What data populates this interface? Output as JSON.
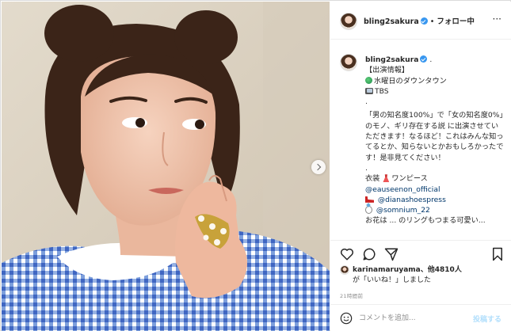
{
  "post": {
    "username": "bling2sakura",
    "separator": "•",
    "follow_label": "フォロー中",
    "more_label": "···",
    "caption": {
      "username": "bling2sakura",
      "after_name": ".",
      "line_1": "【出演情報】",
      "line_2": "水曜日のダウンタウン",
      "line_3": "TBS",
      "dot_1": ".",
      "body": "「男の知名度100%」で「女の知名度0%」のモノ、ギリ存在する説 に出演させていただきます！なるほど！これはみんな知ってるとか、知らないとかおもしろかったです！是非見てください！",
      "dot_2": ".",
      "costume_label": "衣装",
      "costume_item": "ワンピース",
      "tag_1": "@eauseenon_official",
      "tag_2": "@dianashoespress",
      "tag_3": "@somnium_22",
      "cut_line": "お花は ... のリングもつまる可愛い..."
    },
    "likes": {
      "user": "karinamaruyama",
      "others": "、他4810人",
      "suffix": "が「いいね！」しました"
    },
    "time": "21時間前",
    "comment_placeholder": "コメントを追加...",
    "post_label": "投稿する"
  },
  "colors": {
    "verified": "#3897f0",
    "link": "#00376b",
    "post_button": "#b2dffc",
    "border": "#dbdbdb"
  },
  "icons": [
    "heart-icon",
    "comment-icon",
    "share-icon",
    "bookmark-icon",
    "emoji-icon",
    "more-icon",
    "verified-icon"
  ]
}
